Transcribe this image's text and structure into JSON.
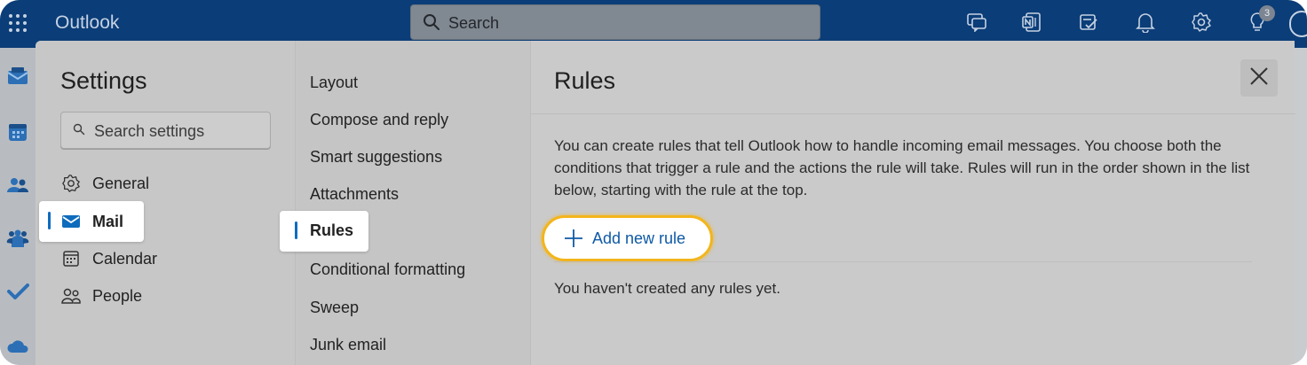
{
  "app": {
    "title": "Outlook",
    "launcher_icon": "app-launcher-icon"
  },
  "search": {
    "placeholder": "Search",
    "icon": "search-icon"
  },
  "top_icons": [
    "feedback-icon",
    "onenote-icon",
    "todo-icon",
    "bell-icon",
    "gear-icon",
    "lightbulb-icon"
  ],
  "notification_count": "3",
  "rail_icons": [
    "mail-icon",
    "calendar-icon",
    "people-icon",
    "groups-icon",
    "todo-check-icon",
    "onedrive-icon"
  ],
  "settings": {
    "title": "Settings",
    "search_placeholder": "Search settings",
    "categories": [
      {
        "label": "General",
        "icon": "gear-icon"
      },
      {
        "label": "Mail",
        "icon": "mail-icon",
        "selected": true
      },
      {
        "label": "Calendar",
        "icon": "calendar-icon"
      },
      {
        "label": "People",
        "icon": "people-icon"
      }
    ],
    "mail_subsections": [
      {
        "label": "Layout"
      },
      {
        "label": "Compose and reply"
      },
      {
        "label": "Smart suggestions"
      },
      {
        "label": "Attachments"
      },
      {
        "label": "Rules",
        "selected": true
      },
      {
        "label": "Conditional formatting"
      },
      {
        "label": "Sweep"
      },
      {
        "label": "Junk email"
      }
    ]
  },
  "rules_panel": {
    "title": "Rules",
    "close_icon": "close-icon",
    "description": "You can create rules that tell Outlook how to handle incoming email messages. You choose both the conditions that trigger a rule and the actions the rule will take. Rules will run in the order shown in the list below, starting with the rule at the top.",
    "add_button": "Add new rule",
    "empty_message": "You haven't created any rules yet."
  },
  "colors": {
    "topbar": "#0b3d78",
    "accent": "#0f6cbd",
    "highlight": "#f3b51b",
    "link": "#0f5aa6"
  }
}
